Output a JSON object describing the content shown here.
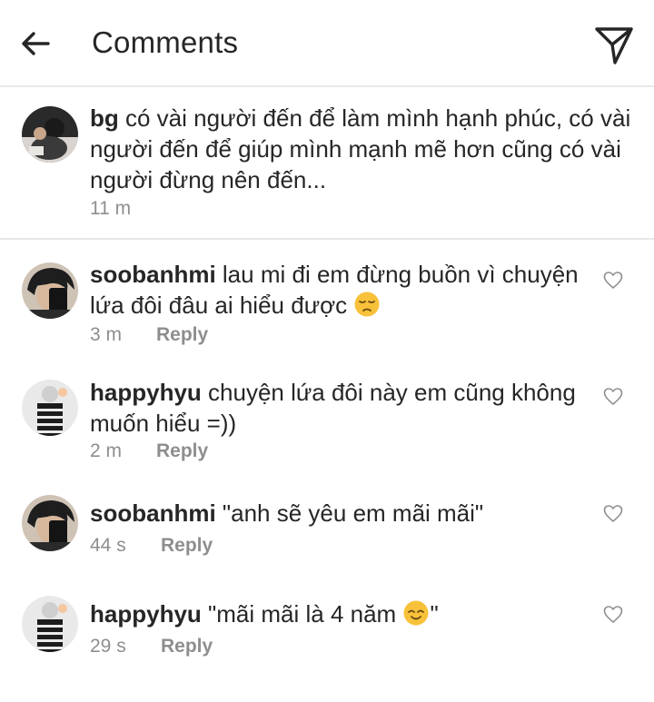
{
  "header": {
    "title": "Comments"
  },
  "caption": {
    "username": "bg",
    "text": "có vài người đến để làm mình hạnh phúc, có vài người đến để giúp mình mạnh mẽ hơn cũng có vài người đừng nên đến...",
    "time": "11 m"
  },
  "comments": [
    {
      "username": "soobanhmi",
      "text": "lau mi đi em đừng buồn vì chuyện lứa đôi đâu ai hiểu được",
      "emoji": "pensive-face",
      "time": "3 m",
      "reply": "Reply"
    },
    {
      "username": "happyhyu",
      "text": "chuyện lứa đôi này em cũng không muốn hiểu =))",
      "time": "2 m",
      "reply": "Reply"
    },
    {
      "username": "soobanhmi",
      "text": "\"anh sẽ yêu em mãi mãi\"",
      "time": "44 s",
      "reply": "Reply"
    },
    {
      "username": "happyhyu",
      "text": "\"mãi mãi là 4 năm",
      "emoji": "relieved-face",
      "text_after": "\"",
      "time": "29 s",
      "reply": "Reply"
    }
  ],
  "colors": {
    "text": "#262626",
    "meta": "#8e8e8e",
    "divider": "#e8e8e8",
    "emoji": "#f7c13a"
  }
}
